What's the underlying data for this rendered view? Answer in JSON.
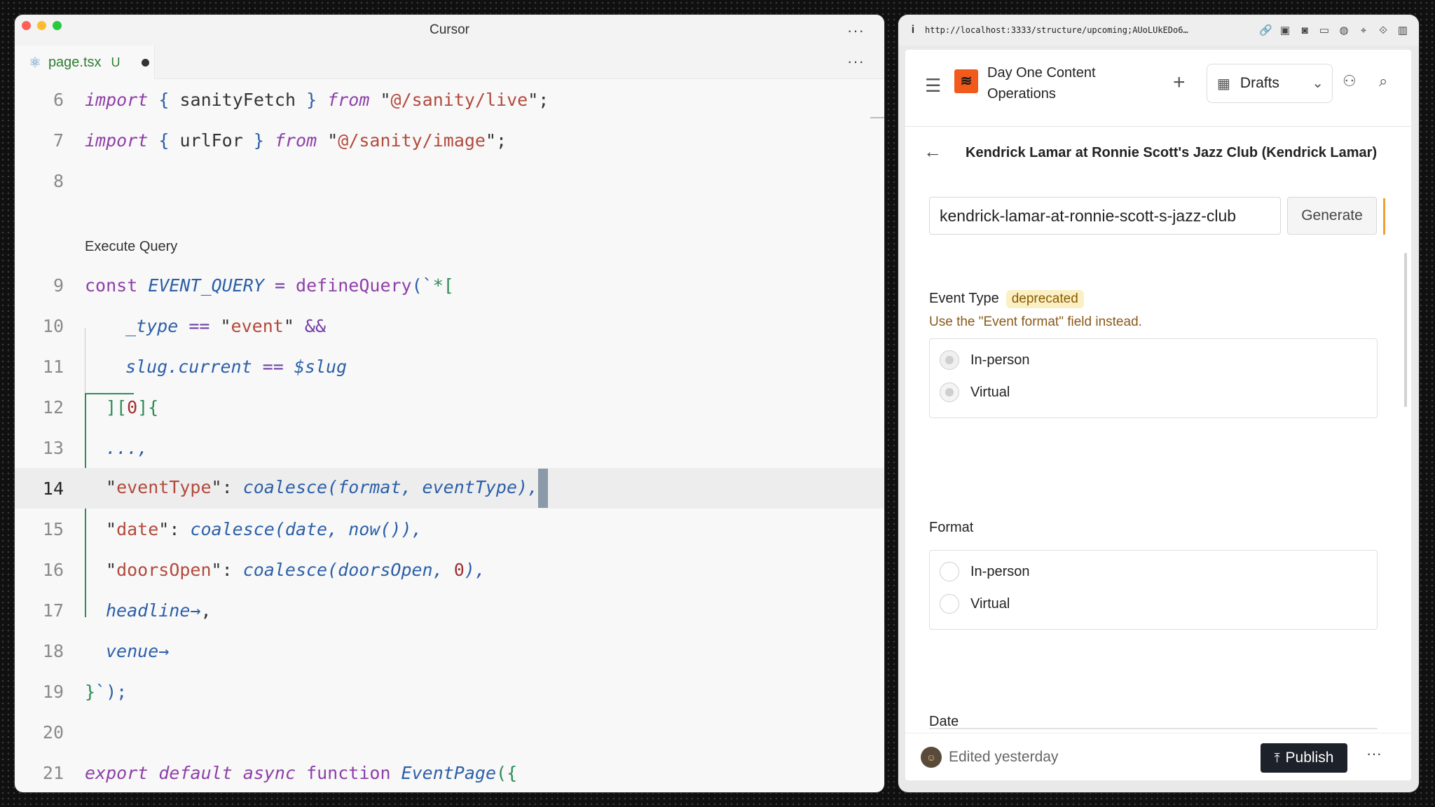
{
  "editor": {
    "window_title": "Cursor",
    "more_label": "···",
    "tab": {
      "icon": "react-icon",
      "filename": "page.tsx",
      "status": "U"
    },
    "codelens": "Execute Query",
    "line_numbers": [
      "6",
      "7",
      "8",
      "9",
      "10",
      "11",
      "12",
      "13",
      "14",
      "15",
      "16",
      "17",
      "18",
      "19",
      "20",
      "21"
    ],
    "lines": {
      "l6": {
        "a": "import",
        "b": " { ",
        "c": "sanityFetch",
        "d": " } ",
        "e": "from",
        "f": " \"",
        "g": "@/sanity/live",
        "h": "\";"
      },
      "l7": {
        "a": "import",
        "b": " { ",
        "c": "urlFor",
        "d": " } ",
        "e": "from",
        "f": " \"",
        "g": "@/sanity/image",
        "h": "\";"
      },
      "l9": {
        "a": "const",
        "b": " EVENT_QUERY",
        "c": " = ",
        "d": "defineQuery",
        "e": "(`",
        "f": "*["
      },
      "l10": {
        "a": "_type",
        "b": " == ",
        "c": "\"",
        "d": "event",
        "e": "\"",
        "f": " &&"
      },
      "l11": {
        "a": "slug.current",
        "b": " == ",
        "c": "$slug"
      },
      "l12": {
        "a": "][",
        "b": "0",
        "c": "]{"
      },
      "l13": {
        "a": "...,"
      },
      "l14": {
        "a": "\"",
        "b": "eventType",
        "c": "\": ",
        "d": "coalesce(format, eventType),",
        "e": ""
      },
      "l15": {
        "a": "\"",
        "b": "date",
        "c": "\": ",
        "d": "coalesce(date, now()),",
        "e": ""
      },
      "l16": {
        "a": "\"",
        "b": "doorsOpen",
        "c": "\": ",
        "d": "coalesce(doorsOpen, ",
        "e": "0",
        "f": "),",
        "g": ""
      },
      "l17": {
        "a": "headline→",
        "b": ","
      },
      "l18": {
        "a": "venue→"
      },
      "l19": {
        "a": "}",
        "b": "`);"
      },
      "l21": {
        "a": "export default async",
        "b": " function ",
        "c": "EventPage",
        "d": "({"
      }
    }
  },
  "browser": {
    "url": "http://localhost:3333/structure/upcoming;AUoLUkEDo6…",
    "toolbar_icons": [
      "link-icon",
      "screenshot-icon",
      "camera-icon",
      "terminal-icon",
      "globe-icon",
      "crosshair-icon",
      "devtools-icon",
      "sidebar-icon"
    ]
  },
  "studio": {
    "project_name": "Day One Content Operations",
    "perspective": "Drafts",
    "document_title": "Kendrick Lamar at Ronnie Scott's Jazz Club (Kendrick Lamar)",
    "slug_value": "kendrick-lamar-at-ronnie-scott-s-jazz-club",
    "generate_label": "Generate",
    "event_type": {
      "label": "Event Type",
      "badge": "deprecated",
      "message": "Use the \"Event format\" field instead.",
      "options": [
        "In-person",
        "Virtual"
      ]
    },
    "format": {
      "label": "Format",
      "options": [
        "In-person",
        "Virtual"
      ]
    },
    "date_label": "Date",
    "footer": {
      "edited": "Edited yesterday",
      "publish_label": "Publish",
      "more_label": "···"
    }
  },
  "colors": {
    "accent_orange": "#f25a1c",
    "publish_bg": "#1d2129",
    "deprecated_bg": "#fbf0c4"
  }
}
